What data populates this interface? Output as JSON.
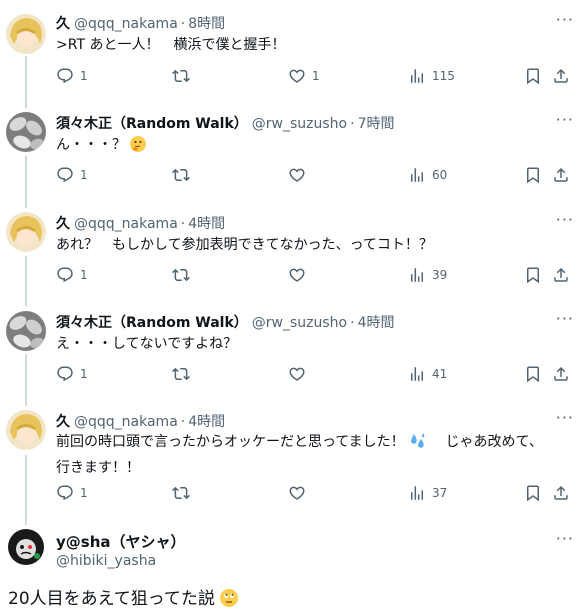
{
  "tweets": [
    {
      "name": "久",
      "handle": "@qqq_nakama",
      "time": "8時間",
      "text": ">RT あと一人！　横浜で僕と握手！",
      "replies": "1",
      "retweets": "",
      "likes": "1",
      "views": "115"
    },
    {
      "name": "須々木正（Random Walk）",
      "handle": "@rw_suzusho",
      "time": "7時間",
      "text": "ん・・・？",
      "replies": "1",
      "retweets": "",
      "likes": "",
      "views": "60"
    },
    {
      "name": "久",
      "handle": "@qqq_nakama",
      "time": "4時間",
      "text": "あれ？　もしかして参加表明できてなかった、ってコト！？",
      "replies": "1",
      "retweets": "",
      "likes": "",
      "views": "39"
    },
    {
      "name": "須々木正（Random Walk）",
      "handle": "@rw_suzusho",
      "time": "4時間",
      "text": "え・・・してないですよね？",
      "replies": "1",
      "retweets": "",
      "likes": "",
      "views": "41"
    },
    {
      "name": "久",
      "handle": "@qqq_nakama",
      "time": "4時間",
      "text_line1": "前回の時口頭で言ったからオッケーだと思ってました！",
      "text_line1b": "　じゃあ改めて、",
      "text_line2": "行きます！！",
      "replies": "1",
      "retweets": "",
      "likes": "",
      "views": "37"
    }
  ],
  "focused": {
    "name": "y@sha（ヤシャ）",
    "handle": "@hibiki_yasha",
    "text": "20人目をあえて狙ってた説"
  },
  "more_label": "···",
  "icons": [
    "reply-icon",
    "retweet-icon",
    "like-icon",
    "views-icon",
    "bookmark-icon",
    "share-icon"
  ]
}
